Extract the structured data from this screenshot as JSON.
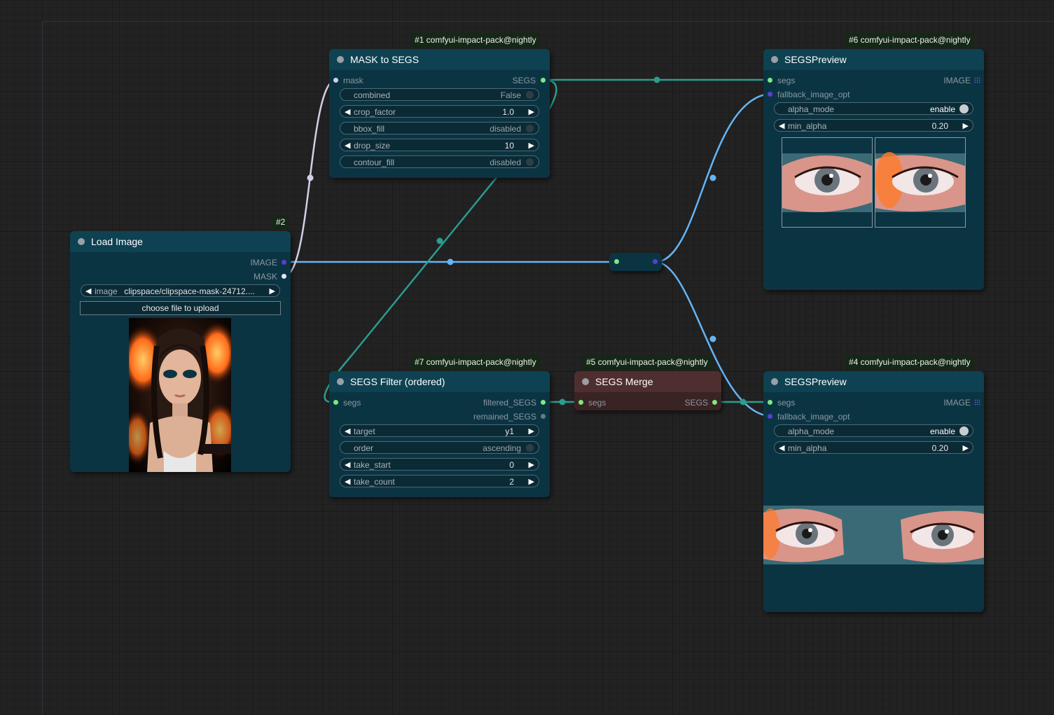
{
  "nodes": {
    "mask_to_segs": {
      "badge": "#1 comfyui-impact-pack@nightly",
      "title": "MASK to SEGS",
      "input": "mask",
      "output": "SEGS",
      "widgets": {
        "combined": {
          "label": "combined",
          "value": "False"
        },
        "crop_factor": {
          "label": "crop_factor",
          "value": "1.0"
        },
        "bbox_fill": {
          "label": "bbox_fill",
          "value": "disabled"
        },
        "drop_size": {
          "label": "drop_size",
          "value": "10"
        },
        "contour_fill": {
          "label": "contour_fill",
          "value": "disabled"
        }
      }
    },
    "load_image": {
      "badge": "#2",
      "title": "Load Image",
      "outputs": {
        "image": "IMAGE",
        "mask": "MASK"
      },
      "image_widget": {
        "label": "image",
        "value": "clipspace/clipspace-mask-24712...."
      },
      "upload_label": "choose file to upload"
    },
    "segs_preview_6": {
      "badge": "#6 comfyui-impact-pack@nightly",
      "title": "SEGSPreview",
      "inputs": {
        "segs": "segs",
        "fallback": "fallback_image_opt"
      },
      "output": "IMAGE",
      "widgets": {
        "alpha_mode": {
          "label": "alpha_mode",
          "value": "enable"
        },
        "min_alpha": {
          "label": "min_alpha",
          "value": "0.20"
        }
      }
    },
    "segs_filter": {
      "badge": "#7 comfyui-impact-pack@nightly",
      "title": "SEGS Filter (ordered)",
      "input": "segs",
      "outputs": {
        "filtered": "filtered_SEGS",
        "remained": "remained_SEGS"
      },
      "widgets": {
        "target": {
          "label": "target",
          "value": "y1"
        },
        "order": {
          "label": "order",
          "value": "ascending"
        },
        "take_start": {
          "label": "take_start",
          "value": "0"
        },
        "take_count": {
          "label": "take_count",
          "value": "2"
        }
      }
    },
    "segs_merge": {
      "badge": "#5 comfyui-impact-pack@nightly",
      "title": "SEGS Merge",
      "input": "segs",
      "output": "SEGS"
    },
    "segs_preview_4": {
      "badge": "#4 comfyui-impact-pack@nightly",
      "title": "SEGSPreview",
      "inputs": {
        "segs": "segs",
        "fallback": "fallback_image_opt"
      },
      "output": "IMAGE",
      "widgets": {
        "alpha_mode": {
          "label": "alpha_mode",
          "value": "enable"
        },
        "min_alpha": {
          "label": "min_alpha",
          "value": "0.20"
        }
      }
    }
  },
  "colors": {
    "canvas": "#222222",
    "node_body": "#0b3443",
    "node_header": "#0e4252",
    "merge_body": "#3a2323",
    "segs_link": "#2a9d8f",
    "image_link": "#64b5f6",
    "mask_link": "#d4cfe8",
    "segs_dot": "#7ee87e",
    "image_dot": "#5a3fd0"
  },
  "icons": [
    "slot-dot-icon",
    "arrow-left-icon",
    "arrow-right-icon",
    "toggle-icon",
    "grid-icon"
  ]
}
